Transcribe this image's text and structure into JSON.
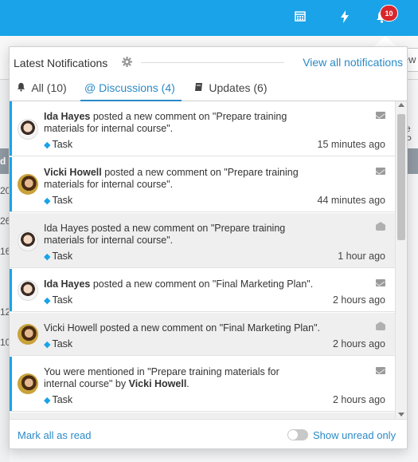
{
  "topbar": {
    "bell_count": "10"
  },
  "background": {
    "toolbar_button": "iew",
    "left_header": "d",
    "left_numbers": [
      "20",
      "26",
      "16",
      "12",
      "10"
    ],
    "right_text": "e P"
  },
  "panel": {
    "title": "Latest Notifications",
    "view_all": "View all notifications",
    "tabs": [
      {
        "label": "All (10)"
      },
      {
        "label": "@ Discussions (4)"
      },
      {
        "label": "Updates (6)"
      }
    ],
    "items": [
      {
        "actor": "Ida Hayes",
        "text": " posted a new comment on \"Prepare training materials for internal course\".",
        "tag": "Task",
        "time": "15 minutes ago"
      },
      {
        "actor": "Vicki Howell",
        "text": " posted a new comment on \"Prepare training materials for internal course\".",
        "tag": "Task",
        "time": "44 minutes ago"
      },
      {
        "text": "Ida Hayes posted a new comment on \"Prepare training materials for internal course\".",
        "tag": "Task",
        "time": "1 hour ago"
      },
      {
        "actor": "Ida Hayes",
        "text": " posted a new comment on \"Final Marketing Plan\".",
        "tag": "Task",
        "time": "2 hours ago"
      },
      {
        "text": "Vicki Howell posted a new comment on \"Final Marketing Plan\".",
        "tag": "Task",
        "time": "2 hours ago"
      },
      {
        "text_pre": "You were mentioned in \"Prepare training materials for internal course\" by ",
        "actor": "Vicki Howell",
        "text_post": ".",
        "tag": "Task",
        "time": "2 hours ago"
      }
    ],
    "footer": {
      "mark_all": "Mark all as read",
      "show_unread": "Show unread only"
    }
  },
  "colors": {
    "topbar": "#1aa3e8",
    "link": "#2b8ac6",
    "badge": "#d9262c"
  }
}
